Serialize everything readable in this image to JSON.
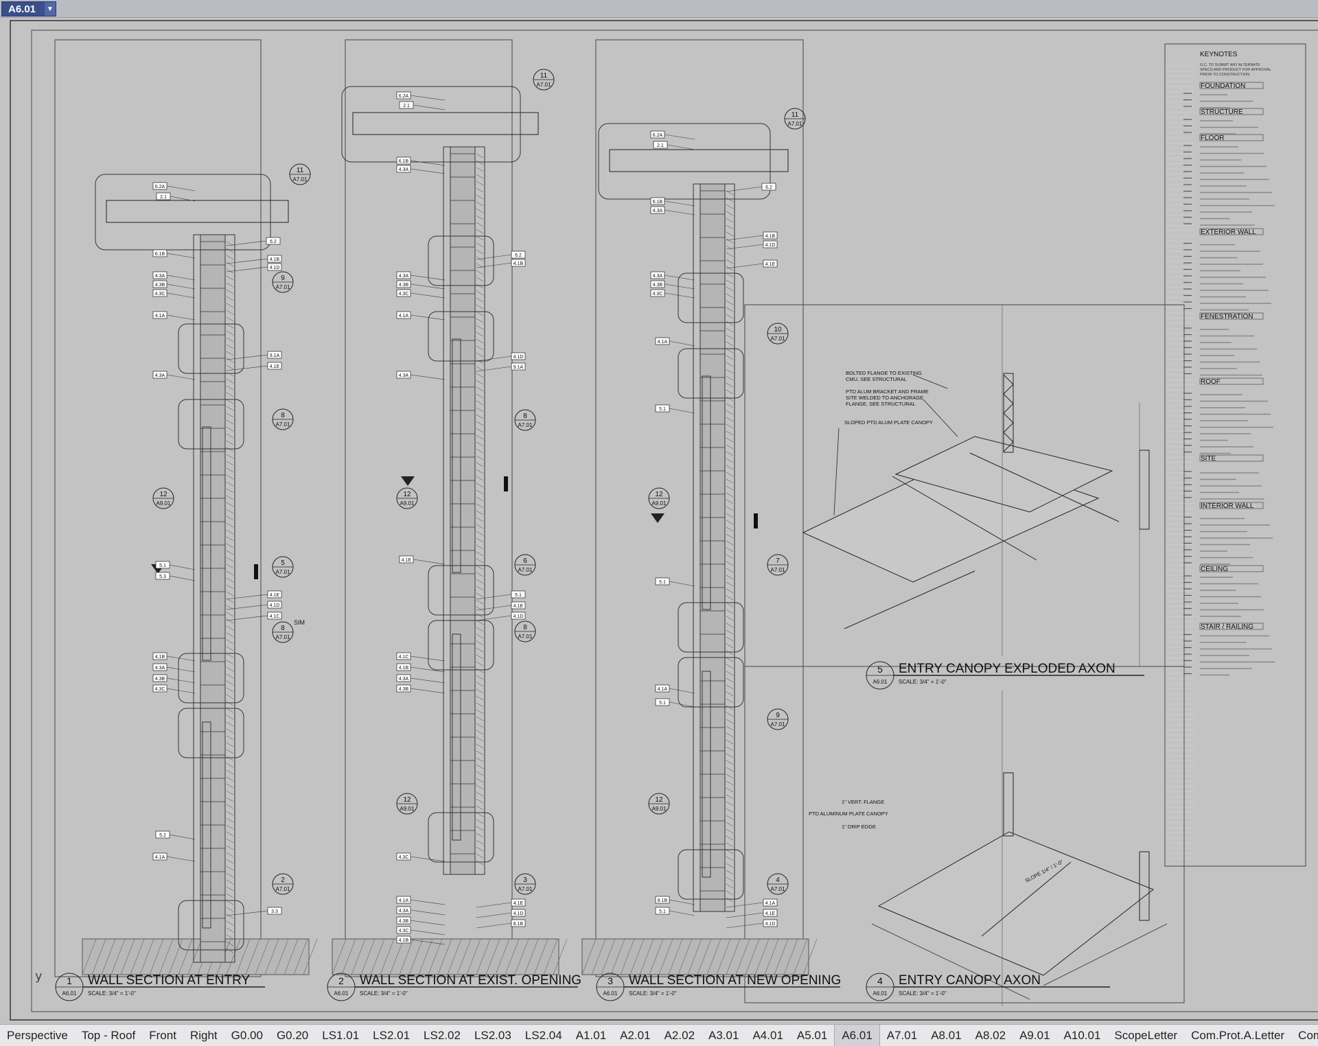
{
  "sheet_selector": {
    "value": "A6.01"
  },
  "axis_label": "y",
  "sections": [
    {
      "num": "1",
      "sheet": "A6.01",
      "title": "WALL SECTION AT ENTRY",
      "scale": "SCALE: 3/4\" = 1'-0\""
    },
    {
      "num": "2",
      "sheet": "A6.01",
      "title": "WALL SECTION AT EXIST. OPENING",
      "scale": "SCALE: 3/4\" = 1'-0\""
    },
    {
      "num": "3",
      "sheet": "A6.01",
      "title": "WALL SECTION AT NEW OPENING",
      "scale": "SCALE: 3/4\" = 1'-0\""
    },
    {
      "num": "4",
      "sheet": "A6.01",
      "title": "ENTRY CANOPY AXON",
      "scale": "SCALE: 3/4\" = 1'-0\""
    },
    {
      "num": "5",
      "sheet": "A6.01",
      "title": "ENTRY CANOPY EXPLODED AXON",
      "scale": "SCALE: 3/4\" = 1'-0\""
    }
  ],
  "callouts": {
    "s1": [
      {
        "num": "11",
        "ref": "A7.01"
      },
      {
        "num": "9",
        "ref": "A7.01"
      },
      {
        "num": "8",
        "ref": "A7.01"
      },
      {
        "num": "5",
        "ref": "A7.01"
      },
      {
        "num": "8",
        "ref": "A7.01"
      },
      {
        "num": "2",
        "ref": "A7.01"
      },
      {
        "num": "12",
        "ref": "A9.01"
      }
    ],
    "s2": [
      {
        "num": "11",
        "ref": "A7.01"
      },
      {
        "num": "8",
        "ref": "A7.01"
      },
      {
        "num": "6",
        "ref": "A7.01"
      },
      {
        "num": "8",
        "ref": "A7.01"
      },
      {
        "num": "3",
        "ref": "A7.01"
      },
      {
        "num": "12",
        "ref": "A9.01"
      },
      {
        "num": "12",
        "ref": "A9.01"
      }
    ],
    "s3": [
      {
        "num": "11",
        "ref": "A7.01"
      },
      {
        "num": "10",
        "ref": "A7.01"
      },
      {
        "num": "7",
        "ref": "A7.01"
      },
      {
        "num": "9",
        "ref": "A7.01"
      },
      {
        "num": "4",
        "ref": "A7.01"
      },
      {
        "num": "12",
        "ref": "A9.01"
      },
      {
        "num": "12",
        "ref": "A9.01"
      }
    ]
  },
  "tags": {
    "s1": [
      "6.2A",
      "2.1",
      "6.1B",
      "4.3A",
      "4.3B",
      "4.3C",
      "4.1A",
      "4.3A",
      "6.2",
      "4.1B",
      "4.1D",
      "9.1A",
      "4.1E",
      "5.1",
      "5.3",
      "4.1E",
      "4.1D",
      "4.1C",
      "4.1B",
      "4.3A",
      "4.3B",
      "4.3C",
      "5.2",
      "4.1A",
      "3.3"
    ],
    "s2": [
      "6.2A",
      "2.1",
      "6.1B",
      "4.3A",
      "4.3A",
      "4.3B",
      "4.3C",
      "4.1A",
      "4.3A",
      "6.2",
      "4.1B",
      "4.1D",
      "9.1A",
      "4.1E",
      "5.1",
      "4.1E",
      "4.1D",
      "4.1C",
      "4.1B",
      "4.3A",
      "4.3B",
      "4.3C",
      "4.1A",
      "4.3A",
      "4.3B",
      "4.3C",
      "4.1B",
      "4.1E",
      "4.1D",
      "8.1B"
    ],
    "s3": [
      "6.2A",
      "2.1",
      "6.1B",
      "4.3A",
      "4.1B",
      "4.1D",
      "4.1E",
      "4.3A",
      "4.3B",
      "4.3C",
      "6.2",
      "4.1A",
      "5.1",
      "5.1",
      "4.1A",
      "5.1",
      "5.1",
      "4.1A",
      "4.1E",
      "4.1D",
      "8.1B"
    ]
  },
  "sim_label": "SIM",
  "exploded_notes": [
    "BOLTED FLANGE TO EXISTING",
    "CMU, SEE STRUCTURAL",
    "PTD ALUM BRACKET AND FRAME",
    "SITE WELDED TO ANCHORAGE",
    "FLANGE, SEE STRUCTURAL",
    "SLOPED PTD ALUM PLATE CANOPY"
  ],
  "axon_notes": [
    "1\" VERT. FLANGE",
    "PTD ALUMINUM PLATE CANOPY",
    "1\" DRIP EDGE",
    "SLOPE 1/4\" / 1'-0\""
  ],
  "keynotes": {
    "title": "KEYNOTES",
    "intro": [
      "G.C. TO SUBMIT ANY ALTERNATE",
      "SPECS AND PRODUCT FOR APPROVAL",
      "PRIOR TO CONSTRUCTION"
    ],
    "headings": [
      "FOUNDATION",
      "STRUCTURE",
      "FLOOR",
      "EXTERIOR WALL",
      "FENESTRATION",
      "ROOF",
      "SITE",
      "INTERIOR WALL",
      "CEILING",
      "STAIR / RAILING"
    ]
  },
  "tabs": [
    {
      "label": "Perspective",
      "active": false
    },
    {
      "label": "Top - Roof",
      "active": false
    },
    {
      "label": "Front",
      "active": false
    },
    {
      "label": "Right",
      "active": false
    },
    {
      "label": "G0.00",
      "active": false
    },
    {
      "label": "G0.20",
      "active": false
    },
    {
      "label": "LS1.01",
      "active": false
    },
    {
      "label": "LS2.01",
      "active": false
    },
    {
      "label": "LS2.02",
      "active": false
    },
    {
      "label": "LS2.03",
      "active": false
    },
    {
      "label": "LS2.04",
      "active": false
    },
    {
      "label": "A1.01",
      "active": false
    },
    {
      "label": "A2.01",
      "active": false
    },
    {
      "label": "A2.02",
      "active": false
    },
    {
      "label": "A3.01",
      "active": false
    },
    {
      "label": "A4.01",
      "active": false
    },
    {
      "label": "A5.01",
      "active": false
    },
    {
      "label": "A6.01",
      "active": true
    },
    {
      "label": "A7.01",
      "active": false
    },
    {
      "label": "A8.01",
      "active": false
    },
    {
      "label": "A8.02",
      "active": false
    },
    {
      "label": "A9.01",
      "active": false
    },
    {
      "label": "A10.01",
      "active": false
    },
    {
      "label": "ScopeLetter",
      "active": false
    },
    {
      "label": "Com.Prot.A.Letter",
      "active": false
    },
    {
      "label": "Com.P",
      "active": false
    }
  ]
}
